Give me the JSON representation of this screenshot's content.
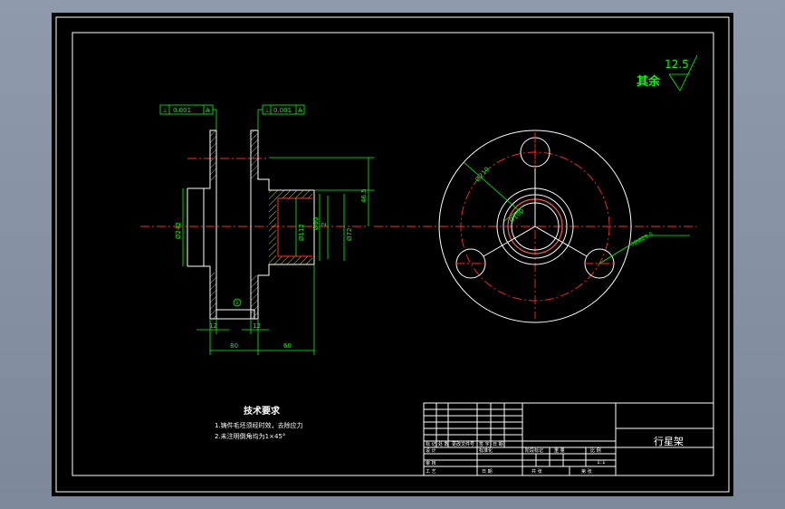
{
  "drawing": {
    "background_color": "#000000",
    "line_color": "#ffffff",
    "dimension_color": "#00ff00",
    "centerline_color": "#ff0000",
    "hatch_color": "#ffff00"
  },
  "roughness": {
    "label": "其余",
    "value": "12.5"
  },
  "section_view": {
    "tolerance_frame_left": [
      "⊥",
      "0.001",
      "A"
    ],
    "tolerance_frame_right": [
      "⊥",
      "0.001",
      "A"
    ],
    "dim_outer_diameter": "Ø242",
    "dim_bore_diameter": "Ø112",
    "dim_inner_diameter": "Ø90",
    "dim_small_diameter": "Ø72",
    "dim_offset": "2",
    "dim_height": "46.5",
    "dim_flange_left": "12",
    "dim_flange_right": "12",
    "dim_total_left": "80",
    "dim_total_right": "60",
    "part_balloon": "1"
  },
  "front_view": {
    "dim_pitch_circle": "Ø210",
    "dim_bore": "Ø100",
    "dim_holes": "3ØØ28.5"
  },
  "tech_notes": {
    "title": "技术要求",
    "items": [
      "1.铸件毛坯须经时效，去除应力",
      "2.未注明倒角均为1×45°"
    ]
  },
  "title_block": {
    "part_name": "行星架",
    "scale_value": "1:1",
    "labels": {
      "mark": "标 记",
      "count": "处 数",
      "file_no": "更改文件号",
      "signature": "签 字",
      "date": "日 期",
      "designer": "设 计",
      "standard": "标准化",
      "stage_mark": "阶段标记",
      "weight": "重 量",
      "scale": "比 例",
      "review": "审 核",
      "process": "工 艺",
      "sheet_total": "共 张",
      "sheet_no": "第 张"
    }
  }
}
